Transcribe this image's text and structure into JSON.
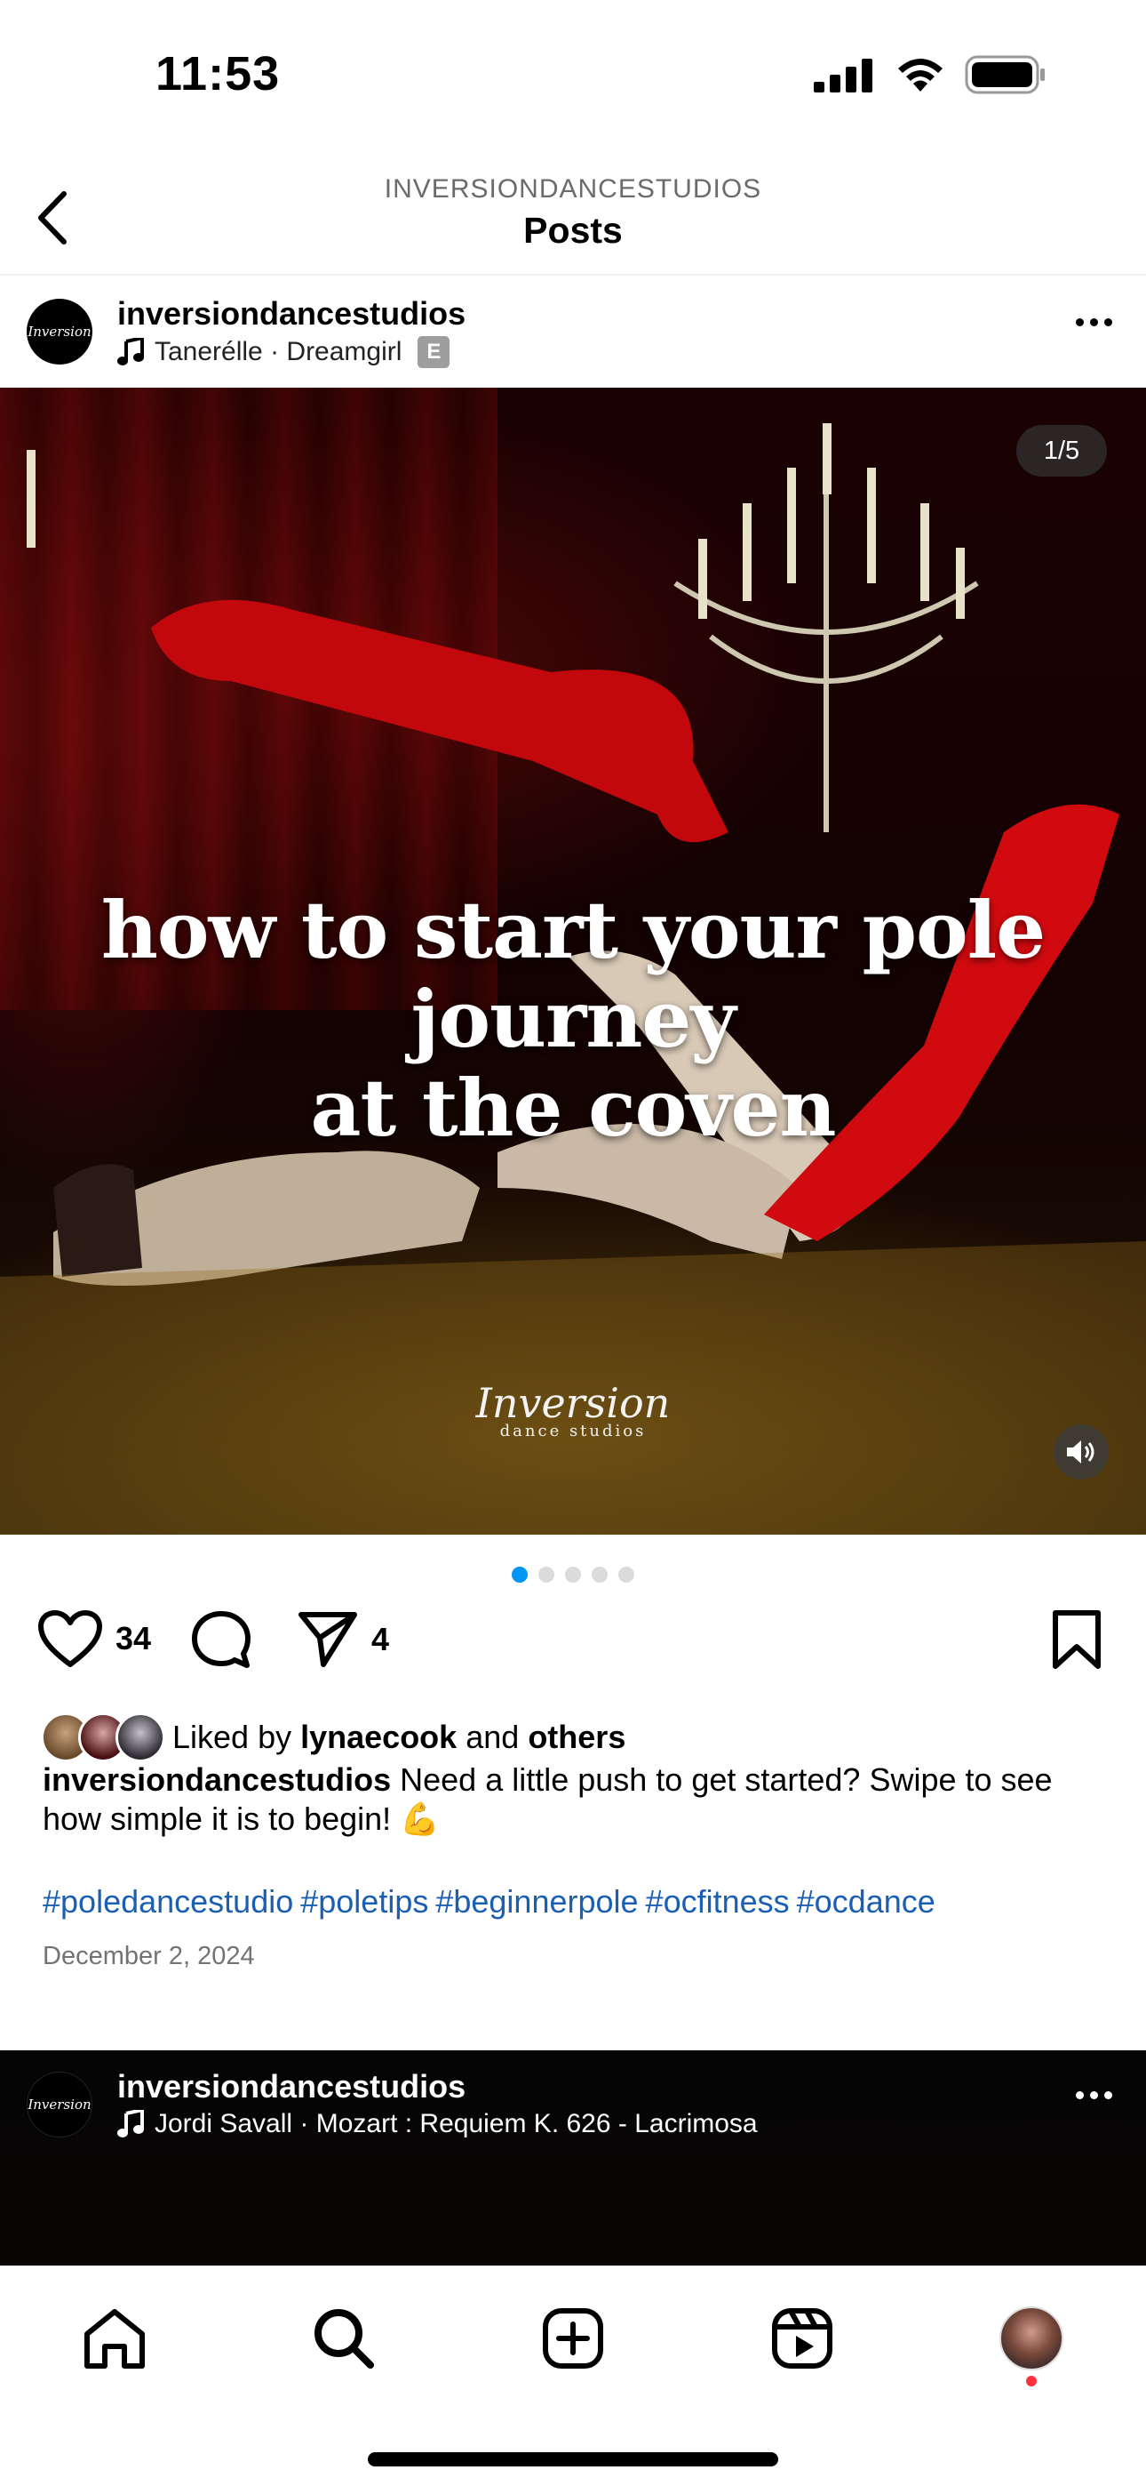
{
  "status_bar": {
    "time": "11:53",
    "icons": [
      "cellular-signal-icon",
      "wifi-icon",
      "battery-icon"
    ]
  },
  "header": {
    "account_label": "INVERSIONDANCESTUDIOS",
    "title": "Posts",
    "back_icon": "chevron-left-icon"
  },
  "post": {
    "username": "inversiondancestudios",
    "audio": "Tanerélle · Dreamgirl",
    "explicit_badge": "E",
    "avatar_logo": "Inversion",
    "media": {
      "counter": "1/5",
      "overlay_line1": "how to start your pole journey",
      "overlay_line2": "at the coven",
      "watermark": "Inversion",
      "watermark_sub": "dance studios",
      "slide_count": 5,
      "active_slide": 1
    },
    "actions": {
      "likes": "34",
      "shares": "4"
    },
    "liked_by": {
      "prefix": "Liked by",
      "user": "lynaecook",
      "joiner": "and",
      "others": "others"
    },
    "caption": {
      "username": "inversiondancestudios",
      "text": "Need a little push to get started? Swipe to see how simple it is to begin! 💪"
    },
    "hashtags": [
      "#poledancestudio",
      "#poletips",
      "#beginnerpole",
      "#ocfitness",
      "#ocdance"
    ],
    "date": "December 2, 2024"
  },
  "next_post": {
    "username": "inversiondancestudios",
    "audio": "Jordi Savall · Mozart : Requiem K. 626 - Lacrimosa",
    "avatar_logo": "Inversion"
  },
  "tab_bar": {
    "tabs": [
      "home-icon",
      "search-icon",
      "new-post-icon",
      "reels-icon",
      "profile-avatar"
    ],
    "accent_colors": {
      "active_dot": "#0095f6",
      "notification_dot": "#ff3040",
      "hashtag": "#1a5fb4"
    }
  }
}
